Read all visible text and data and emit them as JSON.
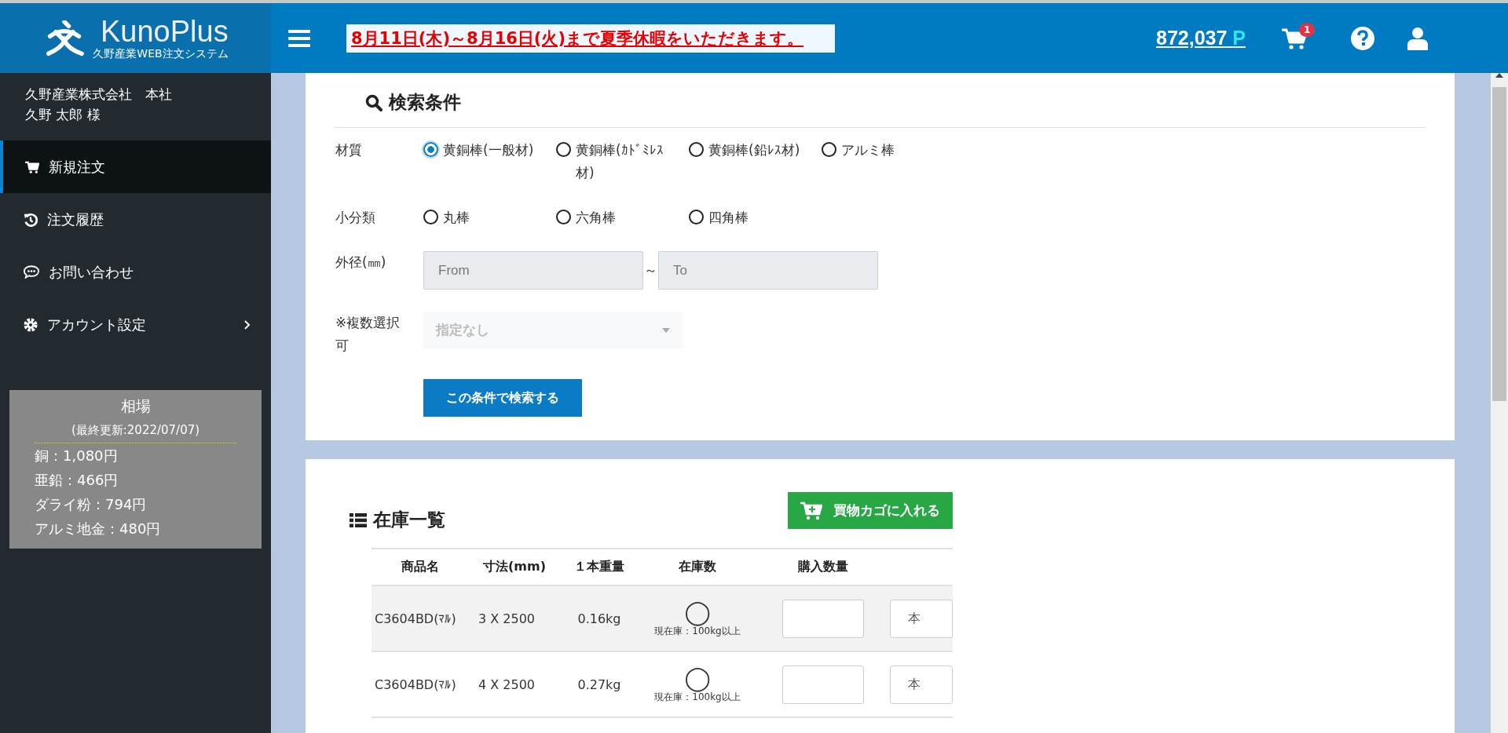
{
  "header": {
    "logo_title": "KunoPlus",
    "logo_subtitle": "久野産業WEB注文システム",
    "notice": "8月11日(木)～8月16日(火)まで夏季休暇をいただきます。",
    "points": "872,037",
    "points_unit": "P",
    "cart_count": "1"
  },
  "sidebar": {
    "company": "久野産業株式会社　本社",
    "user": "久野  太郎 様",
    "items": [
      {
        "label": "新規注文",
        "kind": "cart",
        "selected": true,
        "submenu": false
      },
      {
        "label": "注文履歴",
        "kind": "history",
        "selected": false,
        "submenu": false
      },
      {
        "label": "お問い合わせ",
        "kind": "chat",
        "selected": false,
        "submenu": false
      },
      {
        "label": "アカウント設定",
        "kind": "gear",
        "selected": false,
        "submenu": true
      }
    ],
    "market": {
      "title": "相場",
      "updated": "(最終更新:2022/07/07)",
      "prices": [
        "銅：1,080円",
        "亜鉛：466円",
        "ダライ粉：794円",
        "アルミ地金：480円"
      ]
    }
  },
  "search": {
    "title": "検索条件",
    "material": {
      "label": "材質",
      "options": [
        {
          "label": "黄銅棒(一般材)",
          "selected": true
        },
        {
          "label": "黄銅棒(ｶﾄﾞﾐﾚｽ材)",
          "selected": false
        },
        {
          "label": "黄銅棒(鉛ﾚｽ材)",
          "selected": false
        },
        {
          "label": "アルミ棒",
          "selected": false
        }
      ]
    },
    "subclass": {
      "label": "小分類",
      "options": [
        {
          "label": "丸棒",
          "selected": false
        },
        {
          "label": "六角棒",
          "selected": false
        },
        {
          "label": "四角棒",
          "selected": false
        }
      ]
    },
    "diameter": {
      "label": "外径(㎜)",
      "from_placeholder": "From",
      "separator": "～",
      "to_placeholder": "To"
    },
    "multi": {
      "label": "※複数選択可",
      "placeholder": "指定なし"
    },
    "button": "この条件で検索する"
  },
  "stock": {
    "title": "在庫一覧",
    "cart_button": "買物カゴに入れる",
    "columns": [
      "商品名",
      "寸法(mm)",
      "１本重量",
      "在庫数",
      "購入数量"
    ],
    "rows": [
      {
        "name": "C3604BD(ﾏﾙ)",
        "size": "3 X 2500",
        "weight": "0.16kg",
        "stock": "◯",
        "note": "現在庫：100kg以上",
        "unit": "本"
      },
      {
        "name": "C3604BD(ﾏﾙ)",
        "size": "4 X 2500",
        "weight": "0.27kg",
        "stock": "◯",
        "note": "現在庫：100kg以上",
        "unit": "本"
      }
    ]
  }
}
